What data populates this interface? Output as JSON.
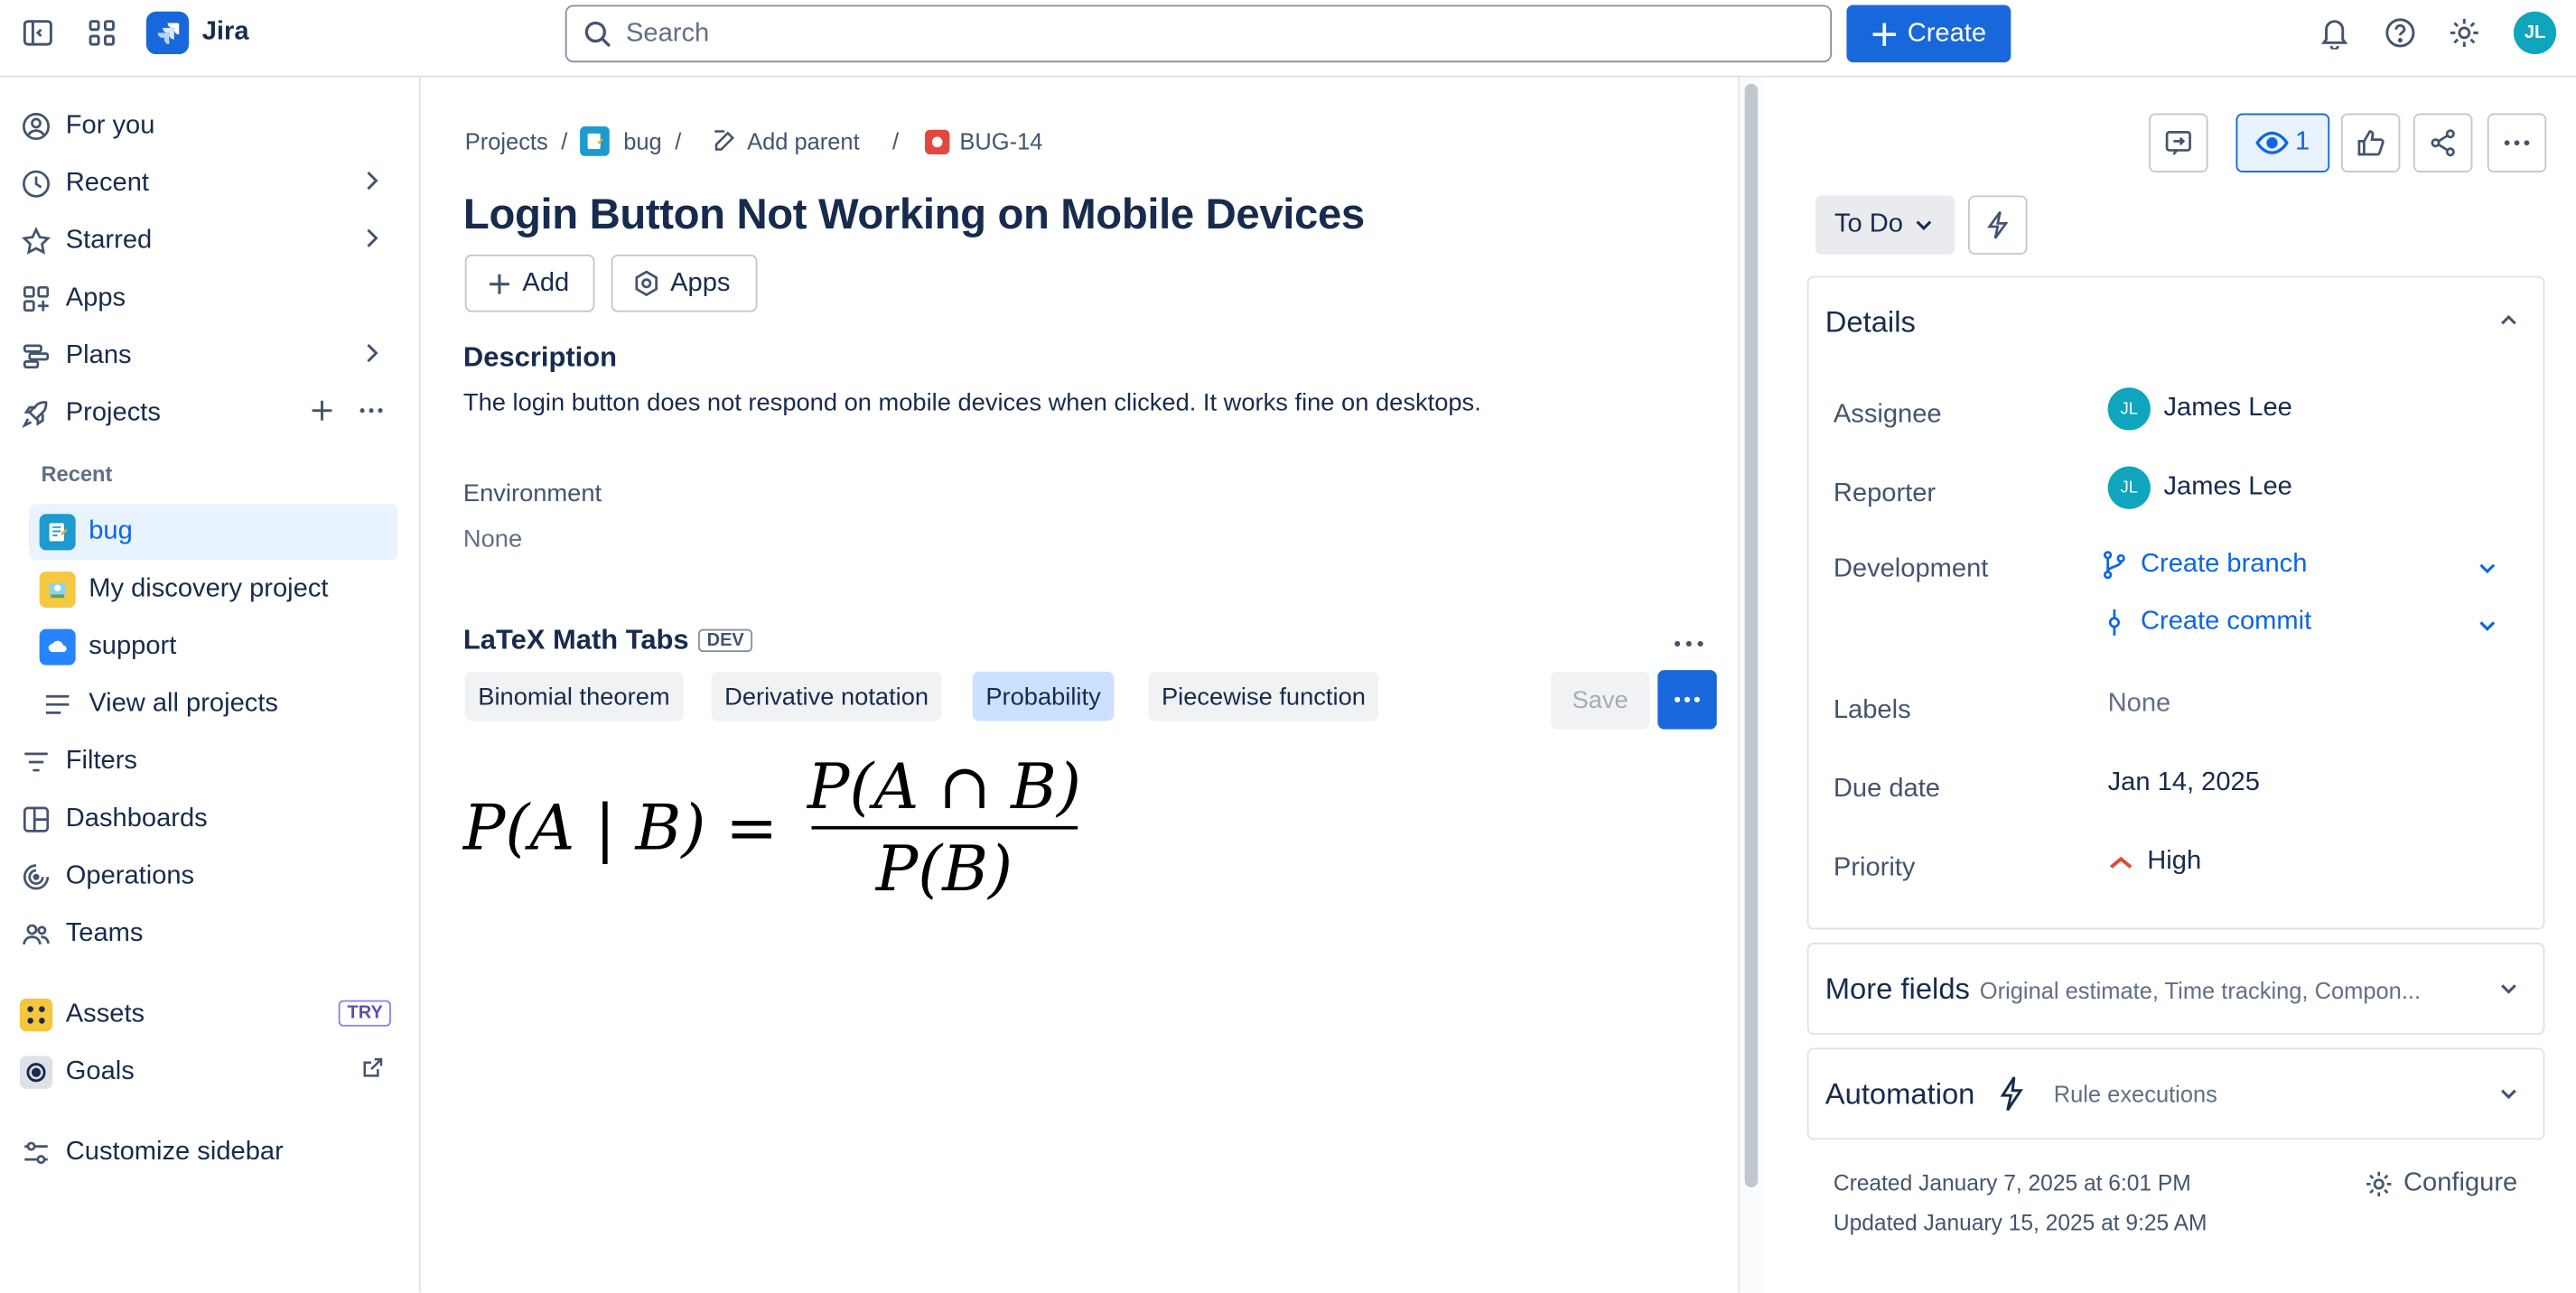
{
  "app": {
    "name": "Jira"
  },
  "topbar": {
    "search_placeholder": "Search",
    "create_label": "Create",
    "avatar_initials": "JL"
  },
  "sidebar": {
    "items": [
      {
        "label": "For you"
      },
      {
        "label": "Recent"
      },
      {
        "label": "Starred"
      },
      {
        "label": "Apps"
      },
      {
        "label": "Plans"
      },
      {
        "label": "Projects"
      }
    ],
    "recent_heading": "Recent",
    "projects": [
      {
        "label": "bug"
      },
      {
        "label": "My discovery project"
      },
      {
        "label": "support"
      }
    ],
    "view_all": "View all projects",
    "items2": [
      {
        "label": "Filters"
      },
      {
        "label": "Dashboards"
      },
      {
        "label": "Operations"
      },
      {
        "label": "Teams"
      }
    ],
    "assets": {
      "label": "Assets",
      "badge": "TRY"
    },
    "goals": {
      "label": "Goals"
    },
    "customize": "Customize sidebar"
  },
  "breadcrumb": {
    "projects": "Projects",
    "project": "bug",
    "add_parent": "Add parent",
    "issue_key": "BUG-14"
  },
  "issue": {
    "title": "Login Button Not Working on Mobile Devices",
    "add_label": "Add",
    "apps_label": "Apps",
    "description_heading": "Description",
    "description": "The login button does not respond on mobile devices when clicked. It works fine on desktops.",
    "environment_label": "Environment",
    "environment_value": "None"
  },
  "latex": {
    "title": "LaTeX Math Tabs",
    "badge": "DEV",
    "tabs": [
      "Binomial theorem",
      "Derivative notation",
      "Probability",
      "Piecewise function"
    ],
    "selected_tab": "Probability",
    "save_label": "Save",
    "formula": {
      "lhs": "P(A | B) =",
      "numerator": "P(A ∩ B)",
      "denominator": "P(B)"
    }
  },
  "right": {
    "watch_count": "1",
    "status": "To Do",
    "details": {
      "title": "Details",
      "assignee_label": "Assignee",
      "assignee": "James Lee",
      "assignee_initials": "JL",
      "reporter_label": "Reporter",
      "reporter": "James Lee",
      "reporter_initials": "JL",
      "development_label": "Development",
      "create_branch": "Create branch",
      "create_commit": "Create commit",
      "labels_label": "Labels",
      "labels_value": "None",
      "due_label": "Due date",
      "due_value": "Jan 14, 2025",
      "priority_label": "Priority",
      "priority_value": "High"
    },
    "more_fields": {
      "title": "More fields",
      "hint": "Original estimate, Time tracking, Compon..."
    },
    "automation": {
      "title": "Automation",
      "hint": "Rule executions"
    },
    "created": "Created January 7, 2025 at 6:01 PM",
    "updated": "Updated January 15, 2025 at 9:25 AM",
    "configure": "Configure"
  },
  "colors": {
    "accent": "#1868db",
    "link": "#0c66e4",
    "selected_tab": "#cce0ff",
    "priority_high": "#e2483d"
  }
}
